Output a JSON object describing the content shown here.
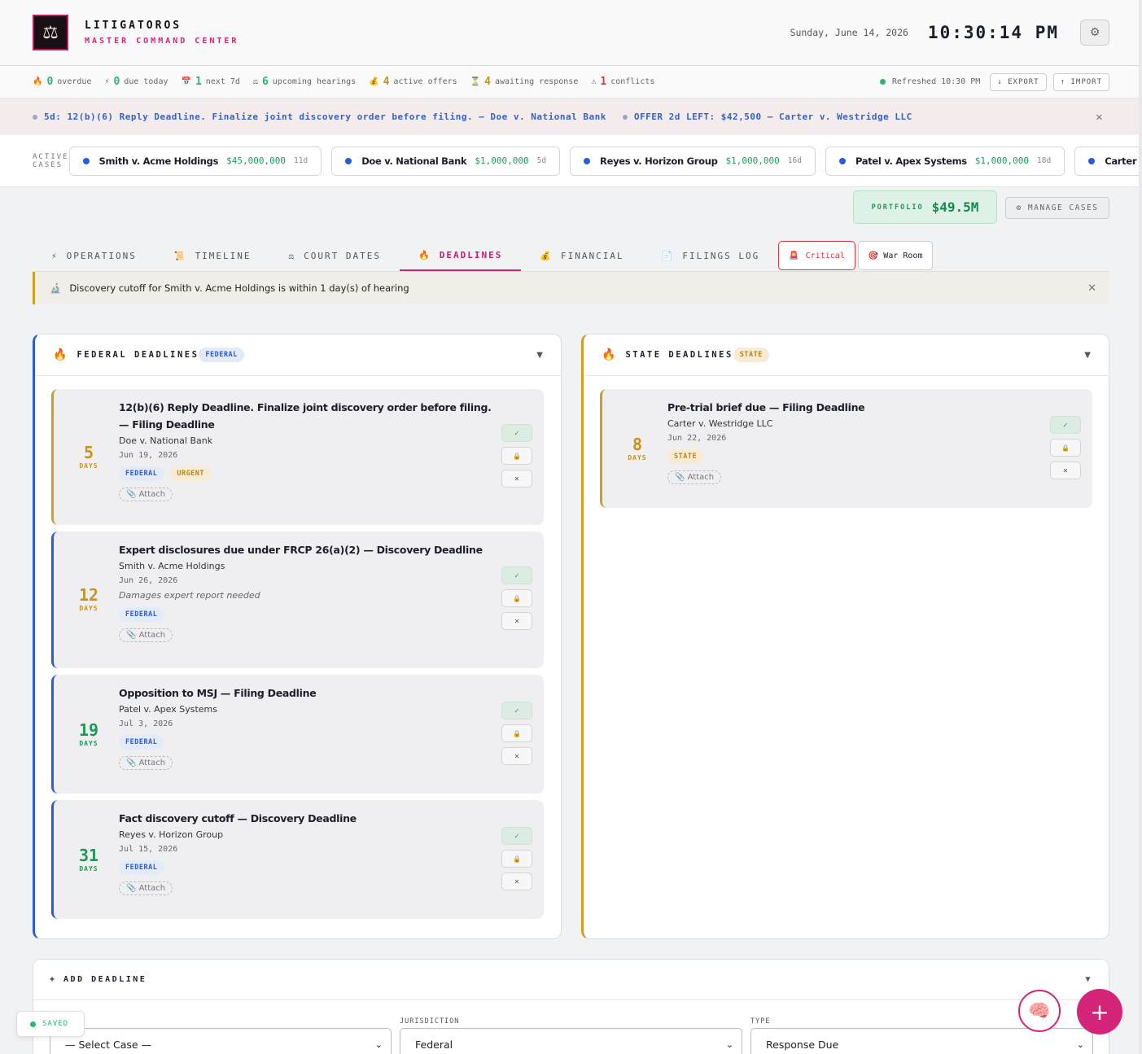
{
  "header": {
    "logo_icon": "scales-of-justice-icon",
    "title": "LITIGATOROS",
    "subtitle": "MASTER COMMAND CENTER",
    "date": "Sunday, June 14, 2026",
    "clock": "10:30:14 PM",
    "settings_icon": "⚙"
  },
  "stats": [
    {
      "icon": "🔥",
      "count": "0",
      "label": "overdue",
      "color": "#2bb673"
    },
    {
      "icon": "⚡",
      "count": "0",
      "label": "due today",
      "color": "#2bb673"
    },
    {
      "icon": "📅",
      "count": "1",
      "label": "next 7d",
      "color": "#2bb673"
    },
    {
      "icon": "⚖",
      "count": "6",
      "label": "upcoming hearings",
      "color": "#2bb673"
    },
    {
      "icon": "💰",
      "count": "4",
      "label": "active offers",
      "color": "#c8921b"
    },
    {
      "icon": "⏳",
      "count": "4",
      "label": "awaiting response",
      "color": "#c8921b"
    },
    {
      "icon": "⚠",
      "count": "1",
      "label": "conflicts",
      "color": "#d8363f"
    }
  ],
  "status": {
    "refreshed": "Refreshed 10:30 PM",
    "export_label": "↓ EXPORT",
    "import_label": "↑ IMPORT"
  },
  "ticker": {
    "item1": "5d: 12(b)(6) Reply Deadline. Finalize joint discovery order before filing. — Doe v. National Bank",
    "item2": "OFFER 2d LEFT: $42,500 — Carter v. Westridge LLC",
    "close": "✕"
  },
  "cases": {
    "label": "ACTIVE CASES",
    "items": [
      {
        "name": "Smith v. Acme Holdings",
        "amount": "$45,000,000",
        "days": "11d"
      },
      {
        "name": "Doe v. National Bank",
        "amount": "$1,000,000",
        "days": "5d"
      },
      {
        "name": "Reyes v. Horizon Group",
        "amount": "$1,000,000",
        "days": "16d"
      },
      {
        "name": "Patel v. Apex Systems",
        "amount": "$1,000,000",
        "days": "18d"
      },
      {
        "name": "Carter v. W",
        "amount": "",
        "days": ""
      }
    ]
  },
  "portfolio": {
    "label": "PORTFOLIO",
    "value": "$49.5M"
  },
  "manage_cases": "⚙ MANAGE CASES",
  "tabs": [
    {
      "icon": "⚡",
      "label": "OPERATIONS"
    },
    {
      "icon": "📜",
      "label": "TIMELINE"
    },
    {
      "icon": "⚖",
      "label": "COURT DATES"
    },
    {
      "icon": "🔥",
      "label": "DEADLINES"
    },
    {
      "icon": "💰",
      "label": "FINANCIAL"
    },
    {
      "icon": "📄",
      "label": "FILINGS LOG"
    }
  ],
  "tab_buttons": {
    "critical": "Critical",
    "critical_icon": "🚨",
    "war_room": "War Room",
    "war_room_icon": "🎯"
  },
  "alert": {
    "icon": "🔬",
    "text": "Discovery cutoff for Smith v. Acme Holdings is within 1 day(s) of hearing",
    "close": "✕"
  },
  "federal": {
    "icon": "🔥",
    "title": "FEDERAL DEADLINES",
    "pill": "FEDERAL",
    "cards": [
      {
        "days": "5",
        "unit": "DAYS",
        "title": "12(b)(6) Reply Deadline. Finalize joint discovery order before filing. — Filing Deadline",
        "case": "Doe v. National Bank",
        "date": "Jun 19, 2026",
        "note": "",
        "tag1": "FEDERAL",
        "tag2": "URGENT",
        "attach": "📎 Attach"
      },
      {
        "days": "12",
        "unit": "DAYS",
        "title": "Expert disclosures due under FRCP 26(a)(2) — Discovery Deadline",
        "case": "Smith v. Acme Holdings",
        "date": "Jun 26, 2026",
        "note": "Damages expert report needed",
        "tag1": "FEDERAL",
        "tag2": "",
        "attach": "📎 Attach"
      },
      {
        "days": "19",
        "unit": "DAYS",
        "title": "Opposition to MSJ — Filing Deadline",
        "case": "Patel v. Apex Systems",
        "date": "Jul 3, 2026",
        "note": "",
        "tag1": "FEDERAL",
        "tag2": "",
        "attach": "📎 Attach"
      },
      {
        "days": "31",
        "unit": "DAYS",
        "title": "Fact discovery cutoff — Discovery Deadline",
        "case": "Reyes v. Horizon Group",
        "date": "Jul 15, 2026",
        "note": "",
        "tag1": "FEDERAL",
        "tag2": "",
        "attach": "📎 Attach"
      }
    ]
  },
  "state": {
    "icon": "🔥",
    "title": "STATE DEADLINES",
    "pill": "STATE",
    "cards": [
      {
        "days": "8",
        "unit": "DAYS",
        "title": "Pre-trial brief due — Filing Deadline",
        "case": "Carter v. Westridge LLC",
        "date": "Jun 22, 2026",
        "tag1": "STATE",
        "attach": "📎 Attach"
      }
    ]
  },
  "card_actions": {
    "done": "✓",
    "lock": "🔒",
    "delete": "✕"
  },
  "add_deadline": {
    "title": "+ ADD DEADLINE",
    "chevron": "▼",
    "case_value": "— Select Case —",
    "jurisdiction_label": "JURISDICTION",
    "jurisdiction_value": "Federal",
    "type_label": "TYPE",
    "type_value": "Response Due"
  },
  "saved": "SAVED",
  "brain_icon": "🧠",
  "fab_label": "+"
}
